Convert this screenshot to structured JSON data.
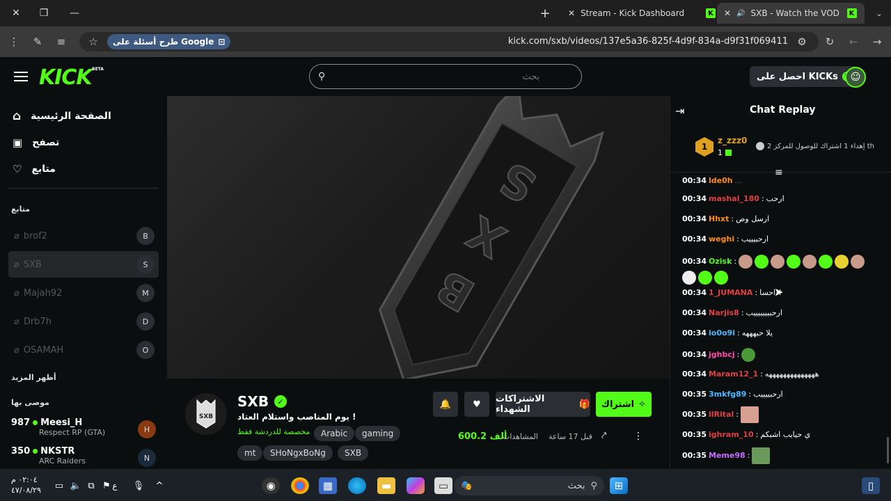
{
  "browser": {
    "tabs": [
      {
        "label": "Stream - Kick Dashboard"
      },
      {
        "label": "SXB - Watch the VOD on Kick"
      }
    ],
    "google_chip": "طرح أسئلة على Google",
    "url": "kick.com/sxb/videos/137e5a36-825f-4d9f-834a-d9f31f069411"
  },
  "header": {
    "logo": "KICK",
    "beta": "BETA",
    "search_placeholder": "بحث",
    "get_kicks": "احصل على KICKs"
  },
  "sidebar": {
    "nav": [
      {
        "label": "الصفحة الرئيسية",
        "icon": "home-icon"
      },
      {
        "label": "تصفح",
        "icon": "browse-icon"
      },
      {
        "label": "متابع",
        "icon": "heart-icon"
      }
    ],
    "following_title": "متابع",
    "following": [
      {
        "name": "brof2",
        "avatar": "B"
      },
      {
        "name": "SXB",
        "avatar": "S"
      },
      {
        "name": "Majah92",
        "avatar": "M"
      },
      {
        "name": "Drb7h",
        "avatar": "D"
      },
      {
        "name": "OSAMAH",
        "avatar": "O"
      }
    ],
    "show_more": "أظهر المزيد",
    "recommended_title": "موصى بها",
    "recommended": [
      {
        "viewers": "987",
        "name": "Meesi_H",
        "category": "Respect RP (GTA)"
      },
      {
        "viewers": "350",
        "name": "NKSTR",
        "category": "ARC Raiders"
      }
    ]
  },
  "channel": {
    "name": "SXB",
    "title": "! يوم المناصب واستلام العتاد",
    "subtitle": "مخصصة للدردشة فقط",
    "tags": [
      "Arabic",
      "gaming",
      "mt",
      "SHoNgxBoNg",
      "SXB"
    ],
    "subscribe": "اشتراك",
    "gift_subs": "الاشتراكات الشهداء",
    "views_label": "المشاهدات",
    "views_value": "600.2 ألف",
    "time_ago": "قبل 17 ساعة"
  },
  "chat": {
    "title": "Chat Replay",
    "pinned": {
      "user": "z_zzz0",
      "rank": "1",
      "count": "1",
      "text": "إهداء 1 اشتراك للوصول للمركز 2 th"
    },
    "messages": [
      {
        "ts": "00:34",
        "user": "mashal_180",
        "color": "#e04040",
        "text": "ارحب"
      },
      {
        "ts": "00:34",
        "user": "Hhxt",
        "color": "#ff8c1a",
        "text": "ارسل وص"
      },
      {
        "ts": "00:34",
        "user": "weghi",
        "color": "#ff8c1a",
        "text": "ارحبيييب"
      },
      {
        "ts": "00:34",
        "user": "Ozisk",
        "color": "#53fc18",
        "text": ""
      },
      {
        "ts": "00:34",
        "user": "1_JUMANA",
        "color": "#e04040",
        "text": "احسا!!"
      },
      {
        "ts": "00:34",
        "user": "Narjis8",
        "color": "#e04040",
        "text": "ارحبيييييييب"
      },
      {
        "ts": "00:34",
        "user": "io0o9i",
        "color": "#4fb8ff",
        "text": "يلا حيهههه"
      },
      {
        "ts": "00:34",
        "user": "jghbcj",
        "color": "#ff4da6",
        "text": ""
      },
      {
        "ts": "00:34",
        "user": "Maram12_1",
        "color": "#e04040",
        "text": "ههههههههههههههه"
      },
      {
        "ts": "00:35",
        "user": "3mkfg89",
        "color": "#4fb8ff",
        "text": "ارحبييييب"
      },
      {
        "ts": "00:35",
        "user": "llRital",
        "color": "#e04040",
        "text": ""
      },
      {
        "ts": "00:35",
        "user": "ighram_10",
        "color": "#e04040",
        "text": "ي حيايب اشبكم"
      },
      {
        "ts": "00:35",
        "user": "Meme98",
        "color": "#c76bff",
        "text": ""
      }
    ]
  },
  "taskbar": {
    "search": "بحث",
    "time": "٠٢:٠٤ م",
    "date": "٤٧/٠٨/٢٩",
    "lang": "ع"
  }
}
